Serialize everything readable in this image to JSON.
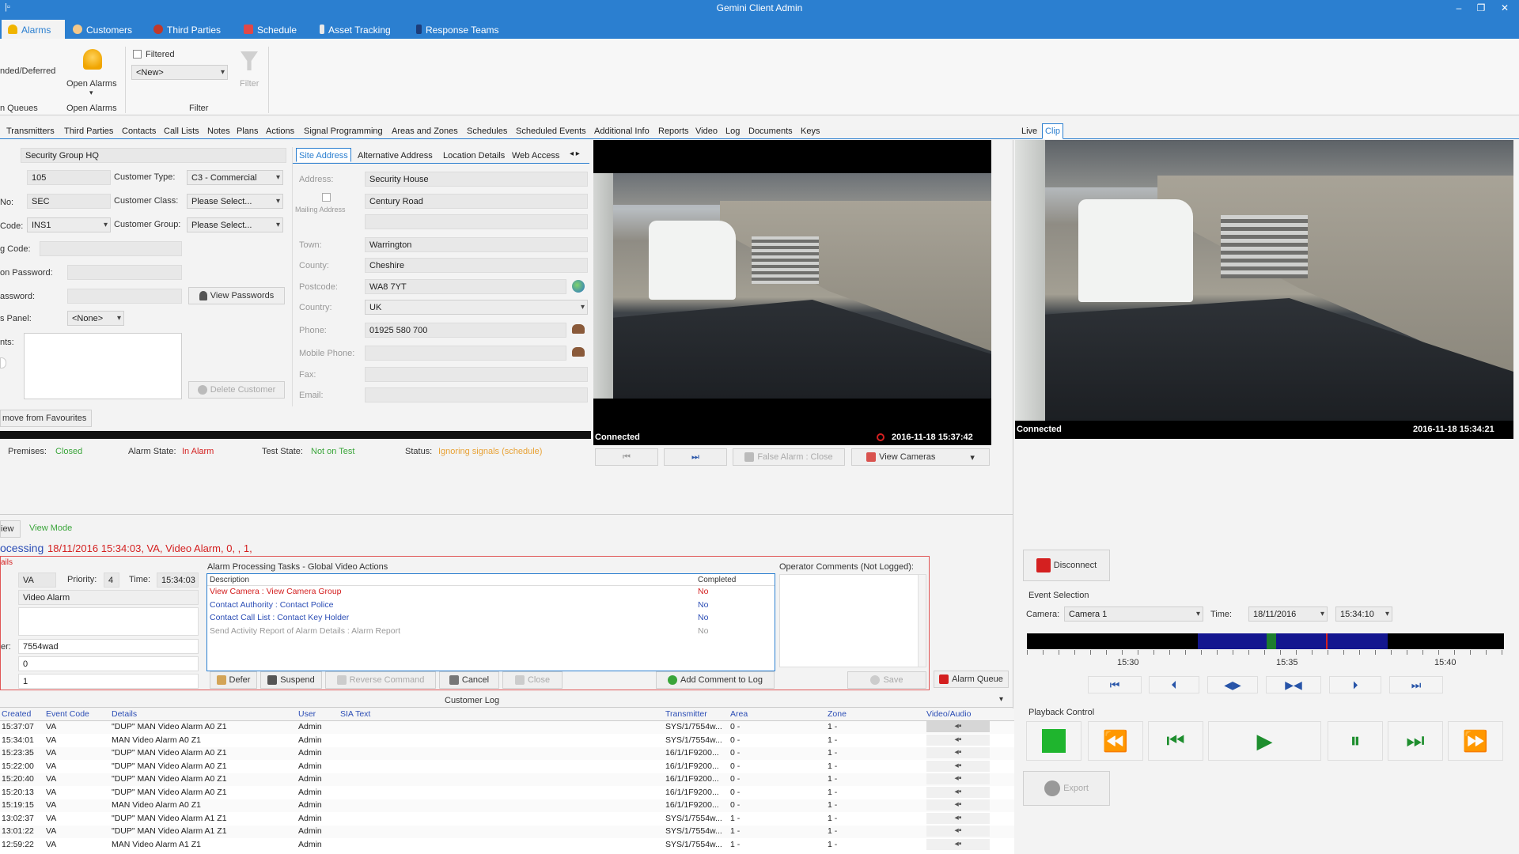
{
  "window": {
    "title": "Gemini Client  Admin",
    "minimize": "–",
    "restore": "❐",
    "close": "✕"
  },
  "nav": {
    "tabs": [
      {
        "label": "Alarms",
        "icon": "bell-icon"
      },
      {
        "label": "Customers",
        "icon": "users-icon"
      },
      {
        "label": "Third Parties",
        "icon": "third-parties-icon"
      },
      {
        "label": "Schedule",
        "icon": "calendar-icon"
      },
      {
        "label": "Asset Tracking",
        "icon": "asset-tracking-icon"
      },
      {
        "label": "Response Teams",
        "icon": "response-teams-icon"
      }
    ]
  },
  "ribbon": {
    "ended_deferred": "nded/Deferred",
    "queues": "n Queues",
    "open_alarms_label": "Open Alarms",
    "open_alarms_group": "Open Alarms",
    "filtered_label": "Filtered",
    "filter_combo": "<New>",
    "filter_button": "Filter",
    "filter_group": "Filter"
  },
  "tabs": {
    "main": [
      "Transmitters",
      "Third Parties",
      "Contacts",
      "Call Lists",
      "Notes",
      "Plans",
      "Actions",
      "Signal Programming",
      "Areas and Zones",
      "Schedules",
      "Scheduled Events",
      "Additional Info",
      "Reports",
      "Video",
      "Log",
      "Documents",
      "Keys"
    ],
    "live_clip": [
      "Live",
      "Clip"
    ],
    "address": [
      "Site Address",
      "Alternative Address",
      "Location Details",
      "Web Access"
    ]
  },
  "customer": {
    "name": "Security Group HQ",
    "id": "105",
    "no_label": "No:",
    "no": "SEC",
    "code_label": "Code:",
    "code": "INS1",
    "g_code_label": "g Code:",
    "on_password_label": "on Password:",
    "password_label": "assword:",
    "panel_label": "s Panel:",
    "panel": "<None>",
    "comments_label": "nts:",
    "type_label": "Customer Type:",
    "type": "C3 - Commercial",
    "class_label": "Customer Class:",
    "class": "Please Select...",
    "group_label": "Customer Group:",
    "group": "Please Select...",
    "view_passwords": "View Passwords",
    "delete_customer": "Delete Customer",
    "remove_favourites": "move from Favourites"
  },
  "address": {
    "address_label": "Address:",
    "line1": "Security House",
    "line2": "Century Road",
    "mailing_label": "Mailing Address",
    "town_label": "Town:",
    "town": "Warrington",
    "county_label": "County:",
    "county": "Cheshire",
    "postcode_label": "Postcode:",
    "postcode": "WA8 7YT",
    "country_label": "Country:",
    "country": "UK",
    "phone_label": "Phone:",
    "phone": "01925 580 700",
    "mobile_label": "Mobile Phone:",
    "fax_label": "Fax:",
    "email_label": "Email:"
  },
  "status": {
    "premises_label": "Premises:",
    "premises": "Closed",
    "alarm_state_label": "Alarm State:",
    "alarm_state": "In Alarm",
    "test_state_label": "Test State:",
    "test_state": "Not on Test",
    "status_label": "Status:",
    "status": "Ignoring signals (schedule)",
    "color_green": "#3aa53a",
    "color_red": "#d42020",
    "color_orange": "#e8a235"
  },
  "video1": {
    "connected": "Connected",
    "timestamp": "2016-11-18  15:37:42",
    "false_alarm": "False Alarm : Close",
    "view_cameras": "View Cameras"
  },
  "video2": {
    "connected": "Connected",
    "timestamp": "2016-11-18  15:34:21"
  },
  "processing": {
    "view_label": "iew",
    "view_mode": "View Mode",
    "heading": "ocessing",
    "detail": "18/11/2016 15:34:03, VA, Video Alarm, 0, , 1,",
    "section_label": "ails",
    "type": "VA",
    "priority_label": "Priority:",
    "priority": "4",
    "time_label": "Time:",
    "time": "15:34:03",
    "desc": "Video Alarm",
    "er_label": "er:",
    "er_value": "7554wad",
    "field_zero": "0",
    "field_one": "1"
  },
  "tasks": {
    "title": "Alarm Processing Tasks - Global Video Actions",
    "col_description": "Description",
    "col_completed": "Completed",
    "rows": [
      {
        "desc": "View Camera : View Camera Group",
        "done": "No"
      },
      {
        "desc": "Contact Authority : Contact Police",
        "done": "No"
      },
      {
        "desc": "Contact Call List : Contact Key Holder",
        "done": "No"
      },
      {
        "desc": "Send Activity Report of Alarm Details : Alarm Report",
        "done": "No"
      }
    ],
    "operator_comments": "Operator Comments (Not Logged):",
    "defer": "Defer",
    "suspend": "Suspend",
    "reverse_command": "Reverse Command",
    "cancel": "Cancel",
    "close": "Close",
    "add_comment": "Add Comment to Log",
    "save": "Save",
    "alarm_queue": "Alarm Queue"
  },
  "log": {
    "title": "Customer Log",
    "columns": [
      "Created",
      "Event Code",
      "Details",
      "User",
      "SIA Text",
      "Transmitter",
      "Area",
      "Zone",
      "Video/Audio"
    ],
    "rows": [
      [
        "15:37:07",
        "VA",
        "\"DUP\" MAN Video Alarm A0 Z1",
        "Admin",
        "",
        "SYS/1/7554w...",
        "0 -",
        "1 -"
      ],
      [
        "15:34:01",
        "VA",
        "MAN Video Alarm A0 Z1",
        "Admin",
        "",
        "SYS/1/7554w...",
        "0 -",
        "1 -"
      ],
      [
        "15:23:35",
        "VA",
        "\"DUP\" MAN Video Alarm A0 Z1",
        "Admin",
        "",
        "16/1/1F9200...",
        "0 -",
        "1 -"
      ],
      [
        "15:22:00",
        "VA",
        "\"DUP\" MAN Video Alarm A0 Z1",
        "Admin",
        "",
        "16/1/1F9200...",
        "0 -",
        "1 -"
      ],
      [
        "15:20:40",
        "VA",
        "\"DUP\" MAN Video Alarm A0 Z1",
        "Admin",
        "",
        "16/1/1F9200...",
        "0 -",
        "1 -"
      ],
      [
        "15:20:13",
        "VA",
        "\"DUP\" MAN Video Alarm A0 Z1",
        "Admin",
        "",
        "16/1/1F9200...",
        "0 -",
        "1 -"
      ],
      [
        "15:19:15",
        "VA",
        "MAN Video Alarm A0 Z1",
        "Admin",
        "",
        "16/1/1F9200...",
        "0 -",
        "1 -"
      ],
      [
        "13:02:37",
        "VA",
        "\"DUP\" MAN Video Alarm A1 Z1",
        "Admin",
        "",
        "SYS/1/7554w...",
        "1 -",
        "1 -"
      ],
      [
        "13:01:22",
        "VA",
        "\"DUP\" MAN Video Alarm A1 Z1",
        "Admin",
        "",
        "SYS/1/7554w...",
        "1 -",
        "1 -"
      ],
      [
        "12:59:22",
        "VA",
        "MAN Video Alarm A1 Z1",
        "Admin",
        "",
        "SYS/1/7554w...",
        "1 -",
        "1 -"
      ]
    ]
  },
  "playback": {
    "disconnect": "Disconnect",
    "event_selection": "Event Selection",
    "camera_label": "Camera:",
    "camera": "Camera 1",
    "time_label": "Time:",
    "date": "18/11/2016",
    "time": "15:34:10",
    "ticks": [
      "15:30",
      "15:35",
      "15:40"
    ],
    "playback_control": "Playback Control",
    "export": "Export"
  }
}
